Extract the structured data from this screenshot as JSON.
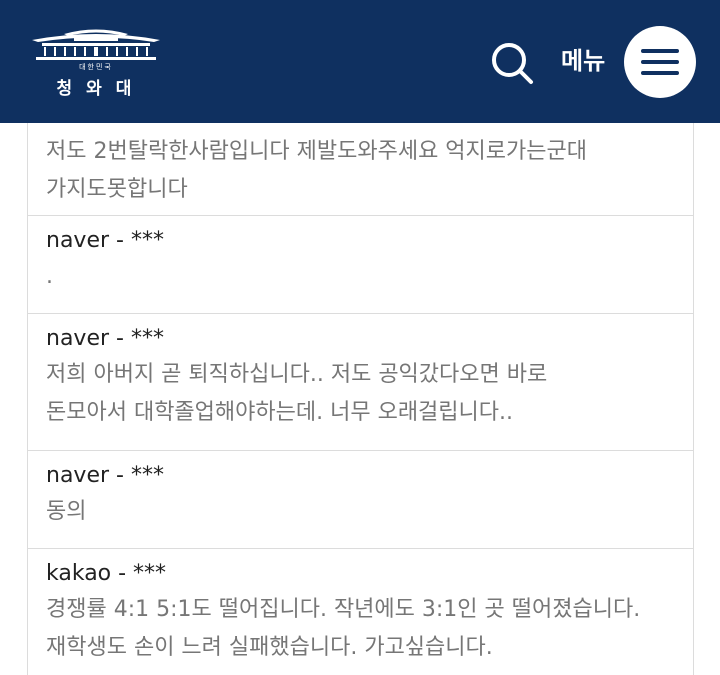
{
  "header": {
    "logo_subtitle": "대한민국",
    "logo_title": "청와대",
    "menu_label": "메뉴",
    "icons": {
      "search": "search-icon",
      "menu": "hamburger-menu-icon",
      "logo": "blue-house-icon"
    },
    "colors": {
      "header_bg": "#0f3060",
      "author_text": "#222222",
      "comment_text": "#767676"
    }
  },
  "comments": [
    {
      "author": "",
      "lines": [
        "저도 2번탈락한사람입니다 제발도와주세요 억지로가는군대",
        "가지도못합니다"
      ]
    },
    {
      "author": "naver - ***",
      "lines": [
        "."
      ]
    },
    {
      "author": "naver - ***",
      "lines": [
        "저희 아버지 곧 퇴직하십니다.. 저도 공익갔다오면 바로",
        "돈모아서 대학졸업해야하는데. 너무 오래걸립니다.."
      ]
    },
    {
      "author": "naver - ***",
      "lines": [
        "동의"
      ]
    },
    {
      "author": "kakao - ***",
      "lines": [
        "경쟁률 4:1 5:1도 떨어집니다. 작년에도 3:1인 곳 떨어졌습니다.",
        "재학생도 손이 느려 실패했습니다. 가고싶습니다."
      ]
    }
  ]
}
